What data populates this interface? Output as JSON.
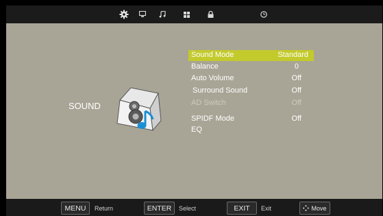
{
  "top_tabs": [
    {
      "name": "gear-icon",
      "label": "Picture/Setup"
    },
    {
      "name": "monitor-icon",
      "label": "Display"
    },
    {
      "name": "music-note-icon",
      "label": "Sound"
    },
    {
      "name": "grid-icon",
      "label": "Channel"
    },
    {
      "name": "lock-icon",
      "label": "Lock"
    },
    {
      "name": "clock-icon",
      "label": "Time"
    }
  ],
  "section": {
    "title": "SOUND"
  },
  "menu": {
    "items": [
      {
        "label": "Sound  Mode",
        "value": "Standard"
      },
      {
        "label": "Balance",
        "value": "0"
      },
      {
        "label": "Auto Volume",
        "value": "Off"
      },
      {
        "label": "Surround Sound",
        "value": "Off"
      },
      {
        "label": "AD Switch",
        "value": "Off"
      },
      {
        "label": "SPIDF Mode",
        "value": "Off"
      },
      {
        "label": "EQ",
        "value": ""
      }
    ],
    "selected_index": 0
  },
  "bottom_bar": {
    "menu_key": "MENU",
    "menu_hint": "Return",
    "enter_key": "ENTER",
    "enter_hint": "Select",
    "exit_key": "EXIT",
    "exit_hint": "Exit",
    "move_key": "Move"
  },
  "colors": {
    "highlight": "#c3ca2c",
    "panel": "#a8a596",
    "bars": "#1b1b1b"
  }
}
